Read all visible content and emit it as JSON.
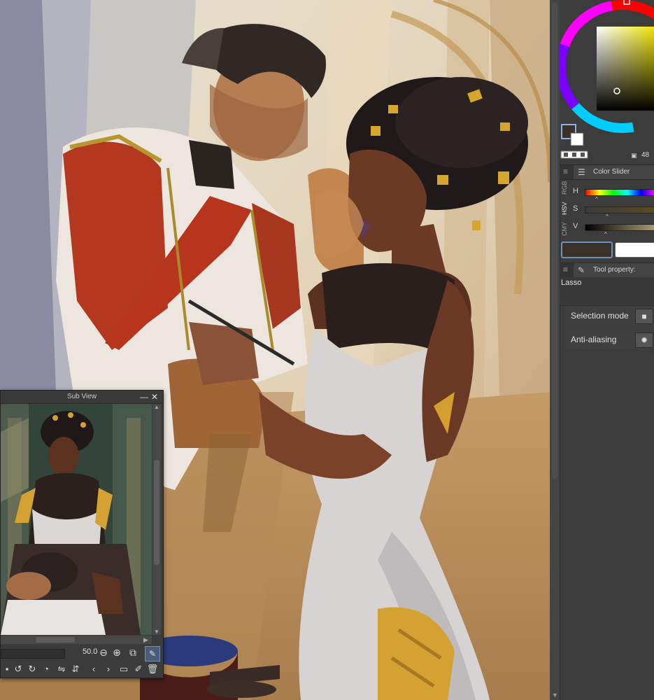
{
  "subview": {
    "title": "Sub View",
    "zoom_value": "50.0",
    "minimize_glyph": "—",
    "close_glyph": "✕"
  },
  "color_panel": {
    "pixel_count": "48",
    "main_color": "#3a3228",
    "sub_color": "#ffffff"
  },
  "color_slider": {
    "tab_label": "Color Slider",
    "modes": [
      "RGB",
      "HSV",
      "CMY"
    ],
    "active_mode": "HSV",
    "sliders": [
      {
        "label": "H",
        "value": 0.2
      },
      {
        "label": "S",
        "value": 0.33
      },
      {
        "label": "V",
        "value": 0.33
      }
    ]
  },
  "tool_property": {
    "tab_label": "Tool property: Lasso",
    "tool_name": "Lasso",
    "rows": [
      {
        "label": "Selection mode",
        "icon": "square-icon"
      },
      {
        "label": "Anti-aliasing",
        "icon": "gear-icon"
      }
    ]
  },
  "icons": {
    "menu": "menu-icon",
    "slider_tab": "color-slider-icon",
    "tool_tab": "lasso-tool-icon"
  }
}
